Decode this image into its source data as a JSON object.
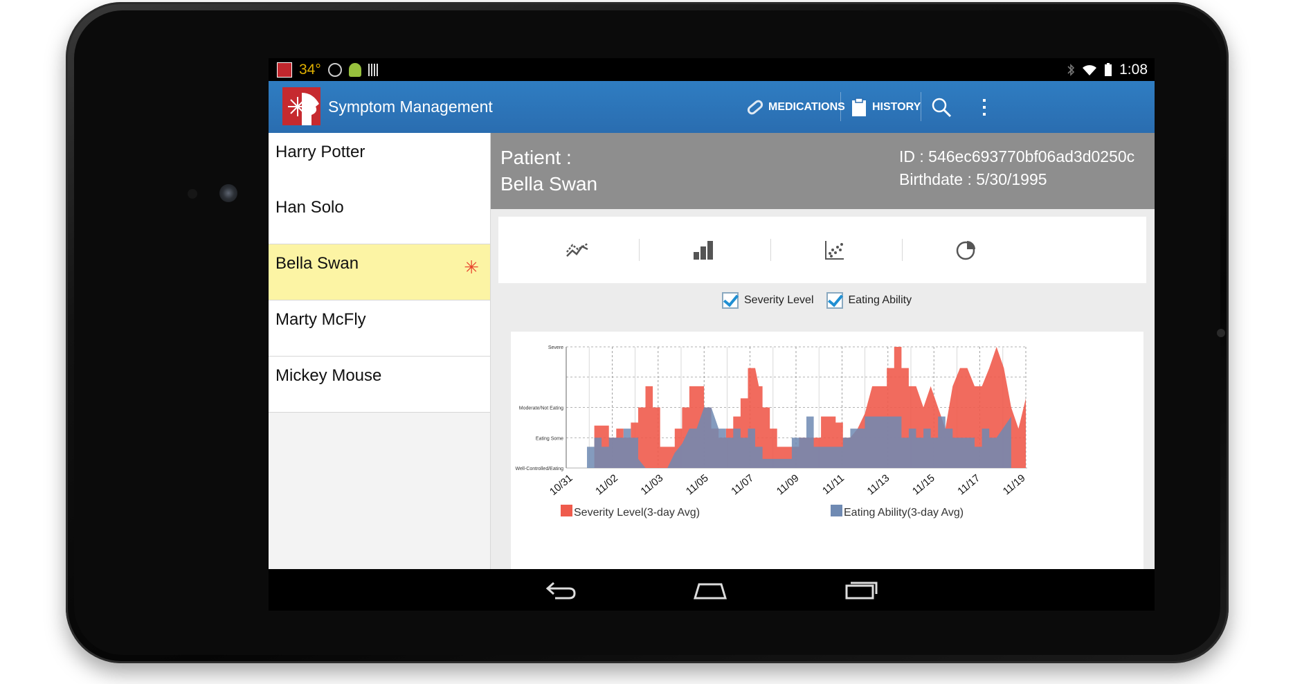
{
  "statusbar": {
    "temperature": "34°",
    "time": "1:08"
  },
  "app": {
    "title": "Symptom Management"
  },
  "actions": {
    "medications": "MEDICATIONS",
    "history": "HISTORY"
  },
  "patients": [
    {
      "name": "Harry Potter",
      "selected": false
    },
    {
      "name": "Han Solo",
      "selected": false
    },
    {
      "name": "Bella Swan",
      "selected": true,
      "flag": "✳"
    },
    {
      "name": "Marty McFly",
      "selected": false
    },
    {
      "name": "Mickey Mouse",
      "selected": false
    }
  ],
  "patient_header": {
    "label": "Patient :",
    "name": "Bella Swan",
    "id_text": "ID : 546ec693770bf06ad3d0250c",
    "birthdate_text": "Birthdate : 5/30/1995"
  },
  "chart_tabs": [
    "line-chart-icon",
    "bar-chart-icon",
    "scatter-chart-icon",
    "pie-chart-icon"
  ],
  "filters": {
    "severity_label": "Severity Level",
    "eating_label": "Eating Ability",
    "severity_checked": true,
    "eating_checked": true
  },
  "chart_data": {
    "type": "area",
    "ylim": [
      0,
      4
    ],
    "y_tick_labels": [
      "Well-Controlled/Eating",
      "Eating Some",
      "Moderate/Not Eating",
      "",
      "Severe"
    ],
    "x_tick_labels": [
      "10/31",
      "11/02",
      "11/03",
      "11/05",
      "11/07",
      "11/09",
      "11/11",
      "11/13",
      "11/15",
      "11/17",
      "11/19"
    ],
    "series": [
      {
        "name": "Severity Level(3-day Avg)",
        "color": "#ef5b4c",
        "values": [
          0,
          0,
          1.4,
          1.4,
          1.0,
          1.0,
          1.3,
          1.3,
          1.0,
          1.0,
          1.5,
          1.5,
          2.0,
          2.0,
          2.7,
          2.7,
          2.0,
          2.0,
          0.7,
          0.7,
          0.7,
          0.7,
          1.3,
          1.3,
          2.0,
          2.0,
          2.7,
          2.7,
          2.7,
          2.0,
          2.0,
          1.3,
          1.3,
          1.0,
          1.0,
          1.3,
          1.3,
          1.7,
          1.7,
          2.3,
          2.3,
          3.3,
          3.3,
          3.3,
          2.7,
          2.7,
          2.0,
          2.0,
          1.3,
          1.3,
          0.7,
          0.7,
          0.7,
          0.7,
          0.7,
          0.7,
          1.0,
          1.0,
          1.0,
          1.0,
          1.0,
          1.0,
          1.7,
          1.7,
          1.7,
          1.7,
          1.5,
          1.5,
          1.0,
          1.0,
          1.0,
          1.3,
          1.3,
          1.8,
          1.8,
          2.7,
          2.7,
          2.7,
          2.7,
          2.7,
          3.3,
          3.3,
          4.0,
          4.0,
          3.3,
          3.3,
          2.7,
          2.7,
          2.7,
          2.0,
          2.0,
          2.7,
          2.7,
          2.0,
          2.0,
          1.3,
          1.3,
          2.7,
          2.7,
          3.3,
          3.3,
          3.3,
          3.3,
          2.7,
          2.7,
          2.7,
          2.7,
          3.3,
          3.3,
          4.0,
          4.0,
          3.3,
          3.3,
          2.0,
          2.0,
          1.3,
          1.3,
          2.3,
          2.3,
          0
        ],
        "x": [
          0,
          1,
          1,
          3,
          3,
          4,
          4,
          5,
          5,
          6,
          6,
          7,
          7,
          8,
          8,
          9,
          9,
          10,
          10,
          11,
          11,
          12,
          12,
          13,
          13,
          14,
          14,
          15,
          16,
          16,
          17,
          17,
          18,
          18,
          19,
          19,
          20,
          20,
          21,
          21,
          22,
          22,
          23,
          23,
          23.5,
          24,
          24,
          25,
          25,
          26,
          26,
          27,
          27,
          28,
          28,
          29,
          29,
          30,
          30,
          31,
          31,
          32,
          32,
          33,
          33,
          34,
          34,
          35,
          35,
          36,
          36,
          37,
          37,
          38,
          38,
          39,
          39,
          40,
          40,
          41,
          41,
          42,
          42,
          43,
          43,
          44,
          44,
          45,
          45,
          46,
          46,
          47,
          47,
          48,
          48,
          49,
          49,
          50,
          50,
          51,
          51,
          52,
          52,
          53,
          53,
          54,
          54,
          55,
          55,
          56,
          56,
          57,
          57,
          58,
          58,
          59,
          59,
          60,
          60,
          60
        ]
      },
      {
        "name": "Eating Ability(3-day Avg)",
        "color": "#6f8ab3",
        "values": [
          0,
          0.7,
          0.7,
          1.0,
          1.0,
          0.7,
          0.7,
          1.0,
          1.0,
          1.3,
          1.3,
          1.0,
          1.0,
          0.3,
          0,
          0,
          0.5,
          0.8,
          1.3,
          1.3,
          2.0,
          2.0,
          1.3,
          1.3,
          1.0,
          1.0,
          1.3,
          1.3,
          1.0,
          1.0,
          1.3,
          1.3,
          0.7,
          0.7,
          0.3,
          0.3,
          0.3,
          0.3,
          1.0,
          1.0,
          1.0,
          1.0,
          1.7,
          1.7,
          0.7,
          0.7,
          0.7,
          0.7,
          1.0,
          1.0,
          1.3,
          1.3,
          1.7,
          1.7,
          1.7,
          1.7,
          1.0,
          1.0,
          1.3,
          1.3,
          1.0,
          1.0,
          1.3,
          1.3,
          1.0,
          1.0,
          1.7,
          1.7,
          1.3,
          1.3,
          1.0,
          1.0,
          1.0,
          1.0,
          0.7,
          0.7,
          1.3,
          1.3,
          1.0,
          1.0,
          1.7,
          0
        ],
        "x": [
          0,
          0,
          1,
          1,
          2,
          2,
          3,
          3,
          5,
          5,
          6,
          6,
          7,
          7,
          8,
          11,
          12,
          13,
          14,
          15,
          16,
          17,
          18,
          19,
          19,
          20,
          20,
          21,
          21,
          22,
          22,
          23,
          23,
          24,
          24,
          27,
          27,
          28,
          28,
          29,
          29,
          30,
          30,
          31,
          31,
          33,
          33,
          35,
          35,
          36,
          36,
          38,
          38,
          41,
          41,
          43,
          43,
          44,
          44,
          45,
          45,
          46,
          46,
          47,
          47,
          48,
          48,
          49,
          49,
          50,
          50,
          52,
          52,
          53,
          53,
          54,
          54,
          55,
          55,
          56,
          58,
          58
        ]
      }
    ],
    "legend": "bottom"
  }
}
